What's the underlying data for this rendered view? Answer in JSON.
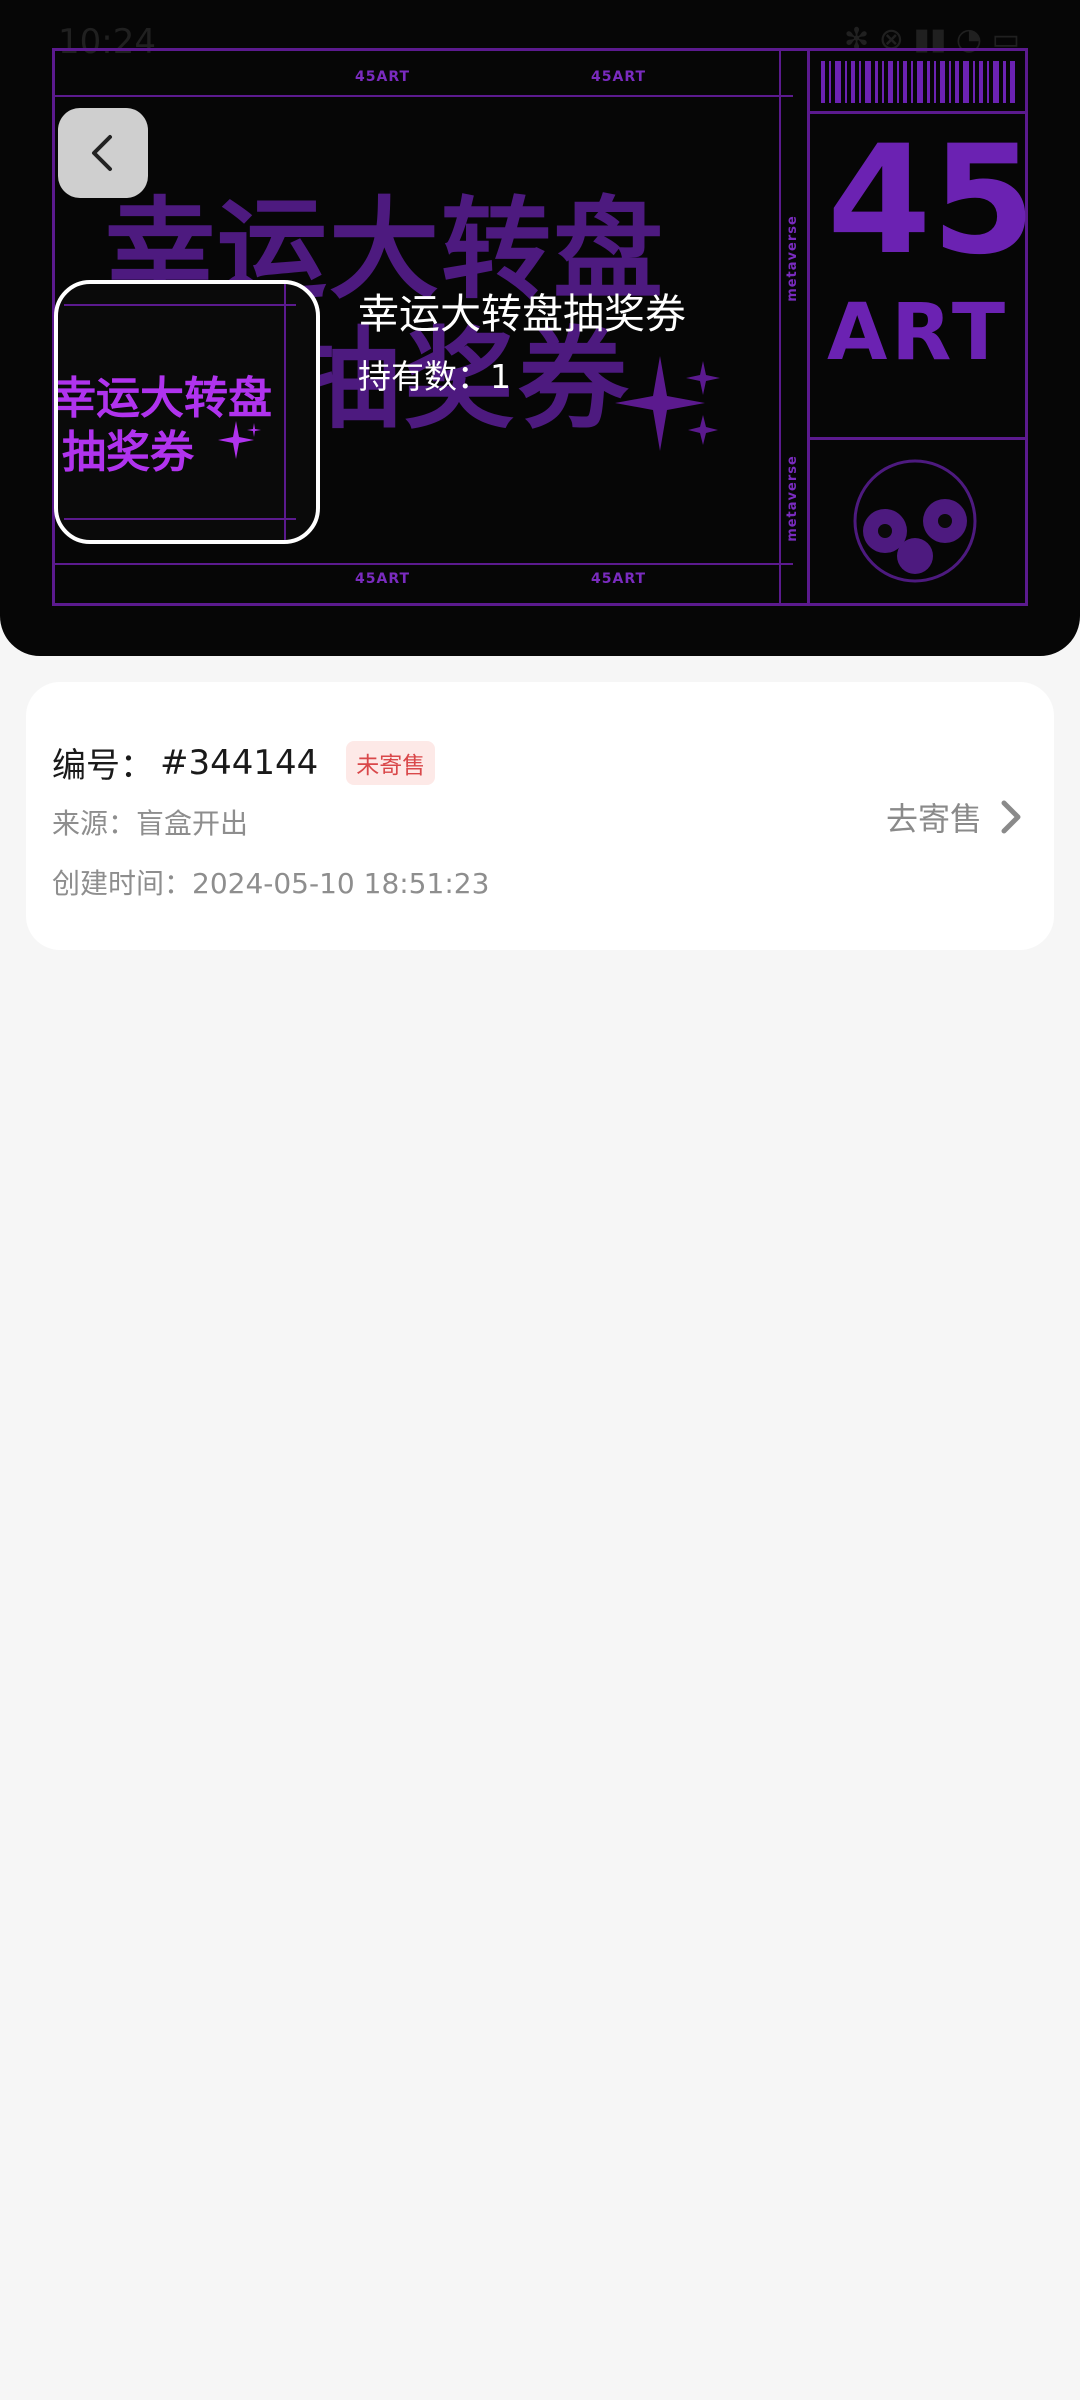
{
  "status_bar": {
    "time": "10:24",
    "icons": "✻ ⊗ ▮▮ ◔ ▭"
  },
  "banner": {
    "brand": "45ART",
    "art_top": "45",
    "art_bottom": "ART",
    "side_text": "metaverse",
    "deco_title_line1": "幸运大转盘",
    "deco_title_line2": "抽奖券",
    "accent_color": "#6b22b2"
  },
  "header": {
    "back_icon": "chevron-left-icon",
    "thumbnail": {
      "line1": "幸运大转盘",
      "line2": "抽奖券"
    },
    "item_name": "幸运大转盘抽奖券",
    "hold_count": "持有数：1"
  },
  "detail_card": {
    "serial_label": "编号：",
    "serial_value": "#344144",
    "status_badge": "未寄售",
    "source": "来源：盲盒开出",
    "created_time": "创建时间：2024-05-10 18:51:23",
    "consign_button": "去寄售",
    "consign_icon": "chevron-right-icon"
  }
}
